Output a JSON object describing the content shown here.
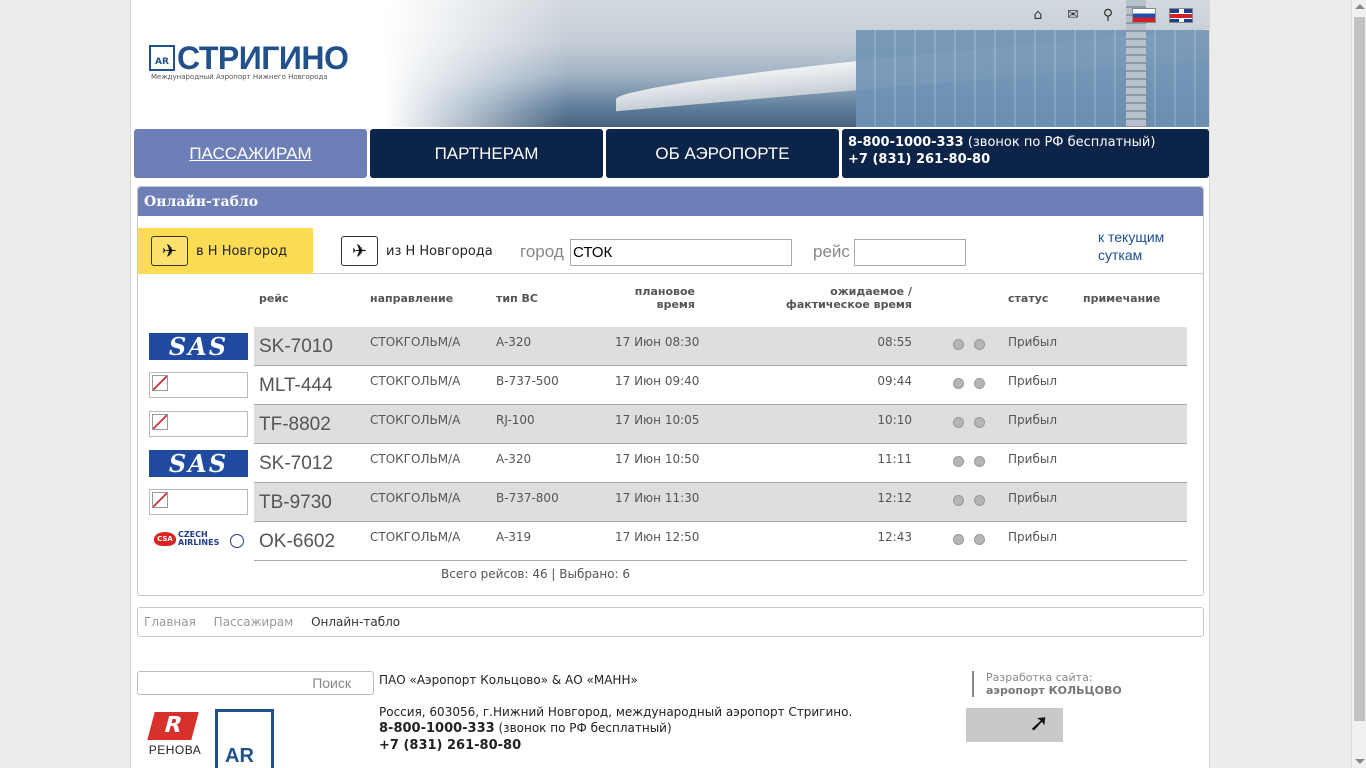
{
  "header": {
    "brand": "СТРИГИНО",
    "brand_badge": "AR",
    "tagline": "Международный Аэропорт Нижнего Новгорода",
    "tools": [
      {
        "icon": "home-icon",
        "glyph": "⌂"
      },
      {
        "icon": "mail-icon",
        "glyph": "✉"
      },
      {
        "icon": "sitemap-search-icon",
        "glyph": "⚲"
      }
    ]
  },
  "nav": {
    "items": [
      "ПАССАЖИРАМ",
      "ПАРТНЕРАМ",
      "ОБ АЭРОПОРТЕ"
    ],
    "phone1": "8-800-1000-333",
    "phone1_note": " (звонок по РФ бесплатный)",
    "phone2": "+7 (831) 261-80-80"
  },
  "board": {
    "title": "Онлайн-табло",
    "arrivals_tab": "в Н Новгород",
    "departures_tab": "из Н Новгорода",
    "city_label": "город",
    "city_value": "СТОК",
    "flight_label": "рейс",
    "flight_value": "",
    "to_today": "к текущим суткам",
    "columns": {
      "flight": "рейс",
      "direction": "направление",
      "aircraft": "тип ВС",
      "planned": "плановое время",
      "expected": "ожидаемое / фактическое время",
      "status": "статус",
      "note": "примечание"
    },
    "rows": [
      {
        "logo": "sas",
        "flight": "SK-7010",
        "direction": "СТОКГОЛЬМ/А",
        "aircraft": "A-320",
        "planned": "17 Июн 08:30",
        "actual": "08:55",
        "status": "Прибыл",
        "note": ""
      },
      {
        "logo": "broken",
        "flight": "MLT-444",
        "direction": "СТОКГОЛЬМ/А",
        "aircraft": "B-737-500",
        "planned": "17 Июн 09:40",
        "actual": "09:44",
        "status": "Прибыл",
        "note": ""
      },
      {
        "logo": "broken",
        "flight": "TF-8802",
        "direction": "СТОКГОЛЬМ/А",
        "aircraft": "RJ-100",
        "planned": "17 Июн 10:05",
        "actual": "10:10",
        "status": "Прибыл",
        "note": ""
      },
      {
        "logo": "sas",
        "flight": "SK-7012",
        "direction": "СТОКГОЛЬМ/А",
        "aircraft": "A-320",
        "planned": "17 Июн 10:50",
        "actual": "11:11",
        "status": "Прибыл",
        "note": ""
      },
      {
        "logo": "broken",
        "flight": "TB-9730",
        "direction": "СТОКГОЛЬМ/А",
        "aircraft": "B-737-800",
        "planned": "17 Июн 11:30",
        "actual": "12:12",
        "status": "Прибыл",
        "note": ""
      },
      {
        "logo": "czech",
        "flight": "OK-6602",
        "direction": "СТОКГОЛЬМ/А",
        "aircraft": "A-319",
        "planned": "17 Июн 12:50",
        "actual": "12:43",
        "status": "Прибыл",
        "note": ""
      }
    ],
    "totals": "Всего рейсов: 46 | Выбрано: 6"
  },
  "logos": {
    "sas": "SAS",
    "czech_badge": "CSA",
    "czech_line1": "CZECH",
    "czech_line2": "AIRLINES"
  },
  "breadcrumbs": [
    "Главная",
    "Пассажирам",
    "Онлайн-табло"
  ],
  "footer": {
    "search_placeholder": "Поиск",
    "org": "ПАО «Аэропорт Кольцово» & АО «МАНН»",
    "address": "Россия, 603056, г.Нижний Новгород, международный аэропорт Стригино.",
    "phone1": "8-800-1000-333",
    "phone1_note": " (звонок по РФ бесплатный)",
    "phone2": "+7 (831) 261-80-80",
    "dev_label": "Разработка сайта:",
    "dev_name": "аэропорт КОЛЬЦОВО",
    "renova_name": "РЕНОВА",
    "renova_mark": "R",
    "ar_badge": "AR",
    "dev_logo_glyph": "➚"
  },
  "colors": {
    "nav_dark": "#0c2447",
    "nav_active": "#6e7fb7",
    "arrivals_tab": "#fcdc55",
    "brand_blue": "#22508b"
  }
}
